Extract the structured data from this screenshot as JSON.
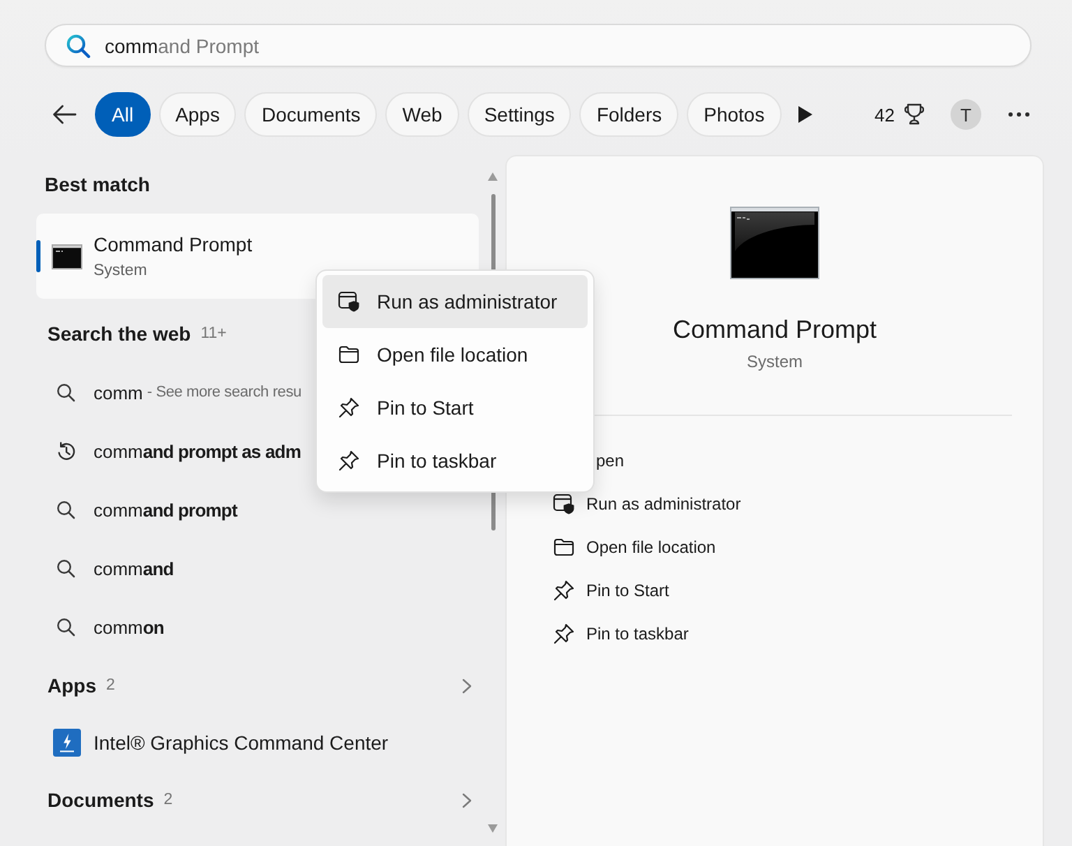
{
  "search": {
    "value": "comm",
    "suggestion": "and Prompt"
  },
  "filters": {
    "tabs": [
      {
        "label": "All",
        "selected": true
      },
      {
        "label": "Apps",
        "selected": false
      },
      {
        "label": "Documents",
        "selected": false
      },
      {
        "label": "Web",
        "selected": false
      },
      {
        "label": "Settings",
        "selected": false
      },
      {
        "label": "Folders",
        "selected": false
      },
      {
        "label": "Photos",
        "selected": false
      }
    ],
    "points": "42",
    "avatar": "T"
  },
  "sections": [
    {
      "heading": "Best match",
      "expandable": false,
      "items": [
        {
          "kind": "best",
          "title": "Command Prompt",
          "subtitle": "System",
          "selected": true
        }
      ]
    },
    {
      "heading": "Search the web",
      "count": "11+",
      "expandable": false,
      "items": [
        {
          "kind": "search",
          "text": "comm",
          "hint": "- See more search resu"
        },
        {
          "kind": "history",
          "text": "comm**and prompt as adm**"
        },
        {
          "kind": "search",
          "text": "comm**and prompt**"
        },
        {
          "kind": "search",
          "text": "comm**and**"
        },
        {
          "kind": "search",
          "text": "comm**on**"
        }
      ]
    },
    {
      "heading": "Apps",
      "count": "2",
      "expandable": true,
      "items": [
        {
          "kind": "app",
          "title": "Intel® Graphics Command Center"
        }
      ]
    },
    {
      "heading": "Documents",
      "count": "2",
      "expandable": true
    }
  ],
  "preview": {
    "title": "Command Prompt",
    "subtitle": "System",
    "actions": [
      {
        "kind": "open",
        "label": "pen"
      },
      {
        "kind": "admin",
        "label": "Run as administrator"
      },
      {
        "kind": "location",
        "label": "Open file location"
      },
      {
        "kind": "pin",
        "label": "Pin to Start"
      },
      {
        "kind": "pin",
        "label": "Pin to taskbar"
      }
    ]
  },
  "context_menu": {
    "items": [
      {
        "kind": "admin",
        "label": "Run as administrator",
        "selected": true
      },
      {
        "kind": "location",
        "label": "Open file location",
        "selected": false
      },
      {
        "kind": "pin",
        "label": "Pin to Start",
        "selected": false
      },
      {
        "kind": "pin",
        "label": "Pin to taskbar",
        "selected": false
      }
    ]
  }
}
